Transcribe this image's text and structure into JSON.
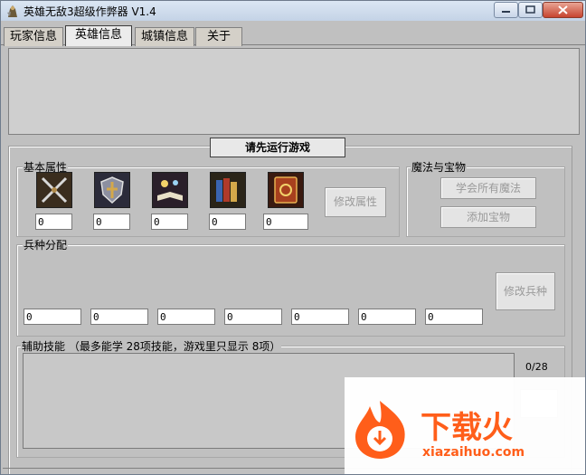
{
  "window": {
    "title": "英雄无敌3超级作弊器 V1.4"
  },
  "tabs": [
    {
      "label": "玩家信息"
    },
    {
      "label": "英雄信息",
      "active": true
    },
    {
      "label": "城镇信息"
    },
    {
      "label": "关于"
    }
  ],
  "run_game_label": "请先运行游戏",
  "basic_attributes": {
    "label": "基本属性",
    "icons": [
      "attack-swords-icon",
      "defense-shield-icon",
      "spell-power-book-icon",
      "knowledge-books-icon",
      "spellbook-icon"
    ],
    "values": [
      "0",
      "0",
      "0",
      "0",
      "0"
    ],
    "modify_button": "修改属性"
  },
  "magic_treasure": {
    "label": "魔法与宝物",
    "learn_all_spells_button": "学会所有魔法",
    "add_treasure_button": "添加宝物"
  },
  "troops": {
    "label": "兵种分配",
    "values": [
      "0",
      "0",
      "0",
      "0",
      "0",
      "0",
      "0"
    ],
    "modify_button": "修改兵种"
  },
  "skills": {
    "label": "辅助技能  （最多能学 28项技能，游戏里只显示 8项）",
    "counter": "0/28"
  },
  "watermark": {
    "brand": "下载火",
    "url": "xiazaihuo.com"
  },
  "colors": {
    "accent": "#ff5e1a",
    "window_bg": "#c0c0c0"
  }
}
